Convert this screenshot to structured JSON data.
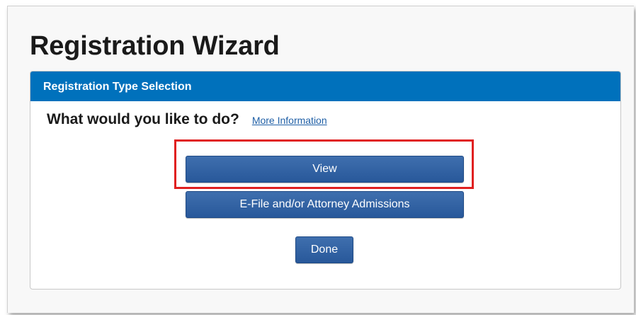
{
  "page": {
    "title": "Registration Wizard"
  },
  "panel": {
    "header": "Registration Type Selection",
    "question": "What would you like to do?",
    "more_info_link": "More Information"
  },
  "buttons": {
    "view": "View",
    "efile": "E-File and/or Attorney Admissions",
    "done": "Done"
  },
  "colors": {
    "header_blue": "#0071bc",
    "button_blue": "#2f5f9f",
    "highlight_red": "#e02020"
  }
}
